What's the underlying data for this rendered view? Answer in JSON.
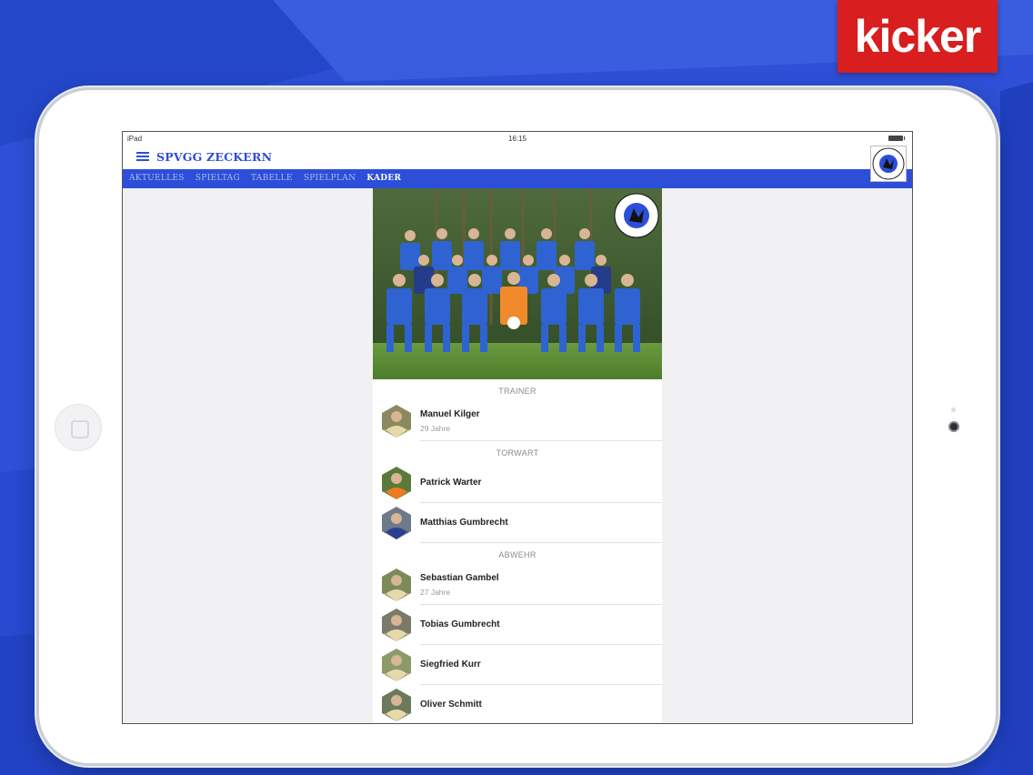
{
  "brand": {
    "logo_text": "kicker",
    "color": "#d81e1e"
  },
  "device": {
    "carrier": "iPad",
    "time": "16:15"
  },
  "app": {
    "title": "SPVGG ZECKERN",
    "accent": "#2d4ed8",
    "crest_text_top": "SPIELVEREINIGUNG",
    "crest_text_bottom": "ZECKERN"
  },
  "nav": {
    "items": [
      {
        "label": "AKTUELLES",
        "active": false
      },
      {
        "label": "SPIELTAG",
        "active": false
      },
      {
        "label": "TABELLE",
        "active": false
      },
      {
        "label": "SPIELPLAN",
        "active": false
      },
      {
        "label": "KADER",
        "active": true
      }
    ]
  },
  "squad": {
    "sections": [
      {
        "title": "TRAINER",
        "players": [
          {
            "name": "Manuel Kilger",
            "age": "29 Jahre",
            "kit": "gold"
          }
        ]
      },
      {
        "title": "TORWART",
        "players": [
          {
            "name": "Patrick Warter",
            "age": "",
            "kit": "orange"
          },
          {
            "name": "Matthias Gumbrecht",
            "age": "",
            "kit": "navy"
          }
        ]
      },
      {
        "title": "ABWEHR",
        "players": [
          {
            "name": "Sebastian Gambel",
            "age": "27 Jahre",
            "kit": "gold"
          },
          {
            "name": "Tobias Gumbrecht",
            "age": "",
            "kit": "gold"
          },
          {
            "name": "Siegfried Kurr",
            "age": "",
            "kit": "gold"
          },
          {
            "name": "Oliver Schmitt",
            "age": "",
            "kit": "gold"
          }
        ]
      }
    ]
  },
  "icons": {
    "menu": "hamburger-icon",
    "battery": "battery-icon",
    "home": "home-button",
    "camera": "camera-icon"
  }
}
